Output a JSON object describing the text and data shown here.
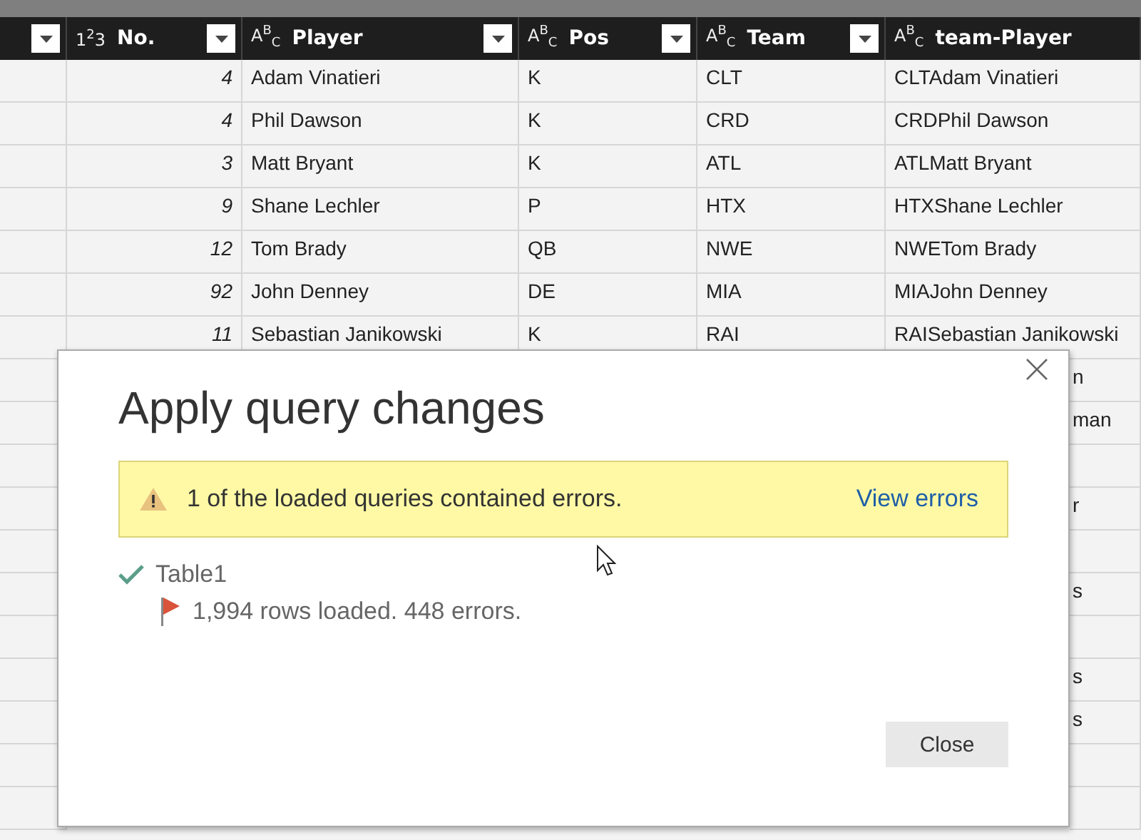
{
  "table": {
    "columns": [
      {
        "kind": "number",
        "type_icon": "1$^{2}$3",
        "label": "No."
      },
      {
        "kind": "text",
        "type_icon": "A$^{B}$$_{C}$",
        "label": "Player"
      },
      {
        "kind": "text",
        "type_icon": "A$^{B}$$_{C}$",
        "label": "Pos"
      },
      {
        "kind": "text",
        "type_icon": "A$^{B}$$_{C}$",
        "label": "Team"
      },
      {
        "kind": "text",
        "type_icon": "A$^{B}$$_{C}$",
        "label": "team-Player"
      }
    ],
    "rows": [
      {
        "kind": "full",
        "cells": [
          "4",
          "Adam Vinatieri",
          "K",
          "CLT",
          "CLTAdam Vinatieri"
        ]
      },
      {
        "kind": "full",
        "cells": [
          "4",
          "Phil Dawson",
          "K",
          "CRD",
          "CRDPhil Dawson"
        ]
      },
      {
        "kind": "full",
        "cells": [
          "3",
          "Matt Bryant",
          "K",
          "ATL",
          "ATLMatt Bryant"
        ]
      },
      {
        "kind": "full",
        "cells": [
          "9",
          "Shane Lechler",
          "P",
          "HTX",
          "HTXShane Lechler"
        ]
      },
      {
        "kind": "full",
        "cells": [
          "12",
          "Tom Brady",
          "QB",
          "NWE",
          "NWETom Brady"
        ]
      },
      {
        "kind": "full",
        "cells": [
          "92",
          "John Denney",
          "DE",
          "MIA",
          "MIAJohn Denney"
        ]
      },
      {
        "kind": "full",
        "cells": [
          "11",
          "Sebastian Janikowski",
          "K",
          "RAI",
          "RAISebastian Janikowski"
        ]
      },
      {
        "kind": "covered",
        "cells": [
          "n"
        ]
      },
      {
        "kind": "covered",
        "cells": [
          "man"
        ]
      },
      {
        "kind": "covered",
        "cells": []
      },
      {
        "kind": "covered",
        "cells": [
          "r"
        ]
      },
      {
        "kind": "covered",
        "cells": []
      },
      {
        "kind": "covered",
        "cells": [
          "s"
        ]
      },
      {
        "kind": "covered",
        "cells": []
      },
      {
        "kind": "covered",
        "cells": [
          "s"
        ]
      },
      {
        "kind": "covered",
        "cells": [
          "s"
        ]
      },
      {
        "kind": "covered",
        "cells": []
      },
      {
        "kind": "covered",
        "cells": []
      }
    ]
  },
  "dialog": {
    "title": "Apply query changes",
    "warning": {
      "text": "1 of the loaded queries contained errors.",
      "link": "View errors"
    },
    "queries": [
      {
        "name": "Table1",
        "status": "1,994 rows loaded. 448 errors.",
        "has_errors": true
      }
    ],
    "buttons": [
      "Close"
    ]
  }
}
